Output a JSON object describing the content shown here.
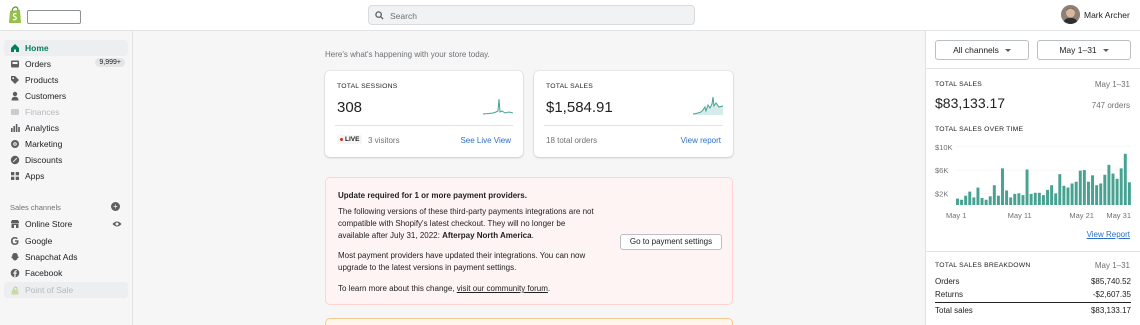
{
  "colors": {
    "accent": "#007f5f",
    "link": "#2c6ecb",
    "chart_bar": "#47a292",
    "sparkline": "#47a292",
    "alert_bg": "#fff4f4",
    "alert_border": "#fed3d1",
    "live_dot": "#d72c0d"
  },
  "header": {
    "logo_icon": "shopify-bag-icon",
    "search_placeholder": "Search",
    "user_name": "Mark Archer"
  },
  "sidebar": {
    "items": [
      {
        "label": "Home",
        "icon": "home-icon",
        "active": true
      },
      {
        "label": "Orders",
        "icon": "orders-icon",
        "badge": "9,999+"
      },
      {
        "label": "Products",
        "icon": "tag-icon"
      },
      {
        "label": "Customers",
        "icon": "person-icon"
      },
      {
        "label": "Finances",
        "icon": "finances-icon",
        "disabled": true
      },
      {
        "label": "Analytics",
        "icon": "analytics-icon"
      },
      {
        "label": "Marketing",
        "icon": "marketing-icon"
      },
      {
        "label": "Discounts",
        "icon": "discount-icon"
      },
      {
        "label": "Apps",
        "icon": "apps-icon"
      }
    ],
    "sales_channels_title": "Sales channels",
    "channels": [
      {
        "label": "Online Store",
        "icon": "store-icon"
      },
      {
        "label": "Google",
        "icon": "google-icon"
      },
      {
        "label": "Snapchat Ads",
        "icon": "snapchat-icon"
      },
      {
        "label": "Facebook",
        "icon": "facebook-icon"
      },
      {
        "label": "Point of Sale",
        "icon": "pos-icon",
        "disabled": true
      }
    ]
  },
  "main": {
    "intro": "Here's what's happening with your store today.",
    "sessions_card": {
      "title": "TOTAL SESSIONS",
      "value": "308",
      "live_label": "LIVE",
      "visitors": "3 visitors",
      "link": "See Live View"
    },
    "sales_card": {
      "title": "TOTAL SALES",
      "value": "$1,584.91",
      "footer": "18 total orders",
      "link": "View report"
    },
    "alert": {
      "title": "Update required for 1 or more payment providers.",
      "body1": "The following versions of these third-party payments integrations are not compatible with Shopify's latest checkout. They will no longer be available after July 31, 2022: ",
      "body1_bold": "Afterpay North America",
      "body1_end": ".",
      "body2": "Most payment providers have updated their integrations. You can now upgrade to the latest versions in payment settings.",
      "body3": "To learn more about this change, ",
      "body3_link": "visit our community forum",
      "body3_end": ".",
      "button": "Go to payment settings"
    }
  },
  "right_panel": {
    "channels_button": "All channels",
    "date_button": "May 1–31",
    "total_sales_title": "TOTAL SALES",
    "total_sales_range": "May 1–31",
    "total_sales_value": "$83,133.17",
    "orders_count": "747 orders",
    "over_time_title": "TOTAL SALES OVER TIME",
    "view_report": "View Report",
    "breakdown_title": "TOTAL SALES BREAKDOWN",
    "breakdown_range": "May 1–31",
    "breakdown": [
      {
        "label": "Orders",
        "value": "$85,740.52"
      },
      {
        "label": "Returns",
        "value": "-$2,607.35"
      },
      {
        "label": "Total sales",
        "value": "$83,133.17"
      }
    ]
  },
  "chart_data": {
    "type": "bar",
    "title": "TOTAL SALES OVER TIME",
    "y_ticks": [
      "$10K",
      "$6K",
      "$2K"
    ],
    "y_tick_values": [
      10000,
      6000,
      2000
    ],
    "x_ticks": [
      "May 1",
      "May 11",
      "May 21",
      "May 31"
    ],
    "ylim": [
      0,
      11000
    ],
    "values": [
      1100,
      900,
      1600,
      2300,
      1300,
      3000,
      1200,
      900,
      1500,
      3400,
      1600,
      6300,
      2500,
      1300,
      1900,
      2000,
      1700,
      6100,
      1900,
      2100,
      2100,
      1700,
      2600,
      3400,
      2000,
      5300,
      3300,
      3000,
      3700,
      4000,
      5900,
      6000,
      4000,
      5100,
      3400,
      3700,
      5200,
      6900,
      5400,
      4500,
      6300,
      8800,
      3900
    ]
  }
}
